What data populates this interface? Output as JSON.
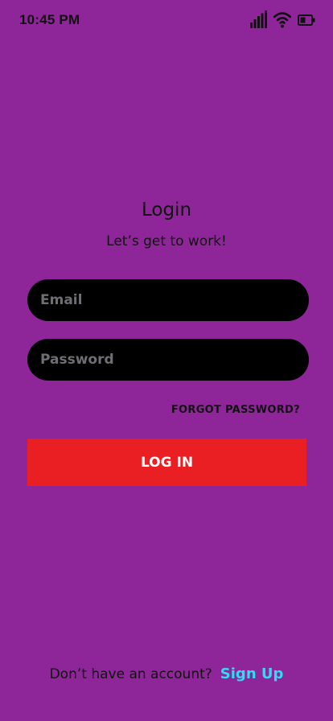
{
  "status_bar": {
    "time": "10:45 PM",
    "icons": [
      "cellular-signal-icon",
      "wifi-icon",
      "battery-icon"
    ]
  },
  "login": {
    "title": "Login",
    "subtitle": "Let’s get to work!",
    "email_placeholder": "Email",
    "email_value": "",
    "password_placeholder": "Password",
    "password_value": "",
    "forgot_password_label": "FORGOT PASSWORD?",
    "login_button_label": "LOG IN"
  },
  "footer": {
    "prompt": "Don’t have an account?",
    "signup_label": "Sign Up"
  },
  "colors": {
    "background": "#8e2599",
    "input_background": "#000000",
    "login_button": "#ea1f24",
    "signup_link": "#2fdcf3"
  }
}
